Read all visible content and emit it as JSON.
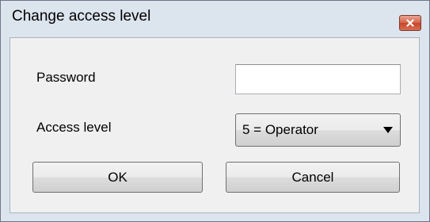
{
  "window": {
    "title": "Change access level",
    "close_icon": "close-icon"
  },
  "form": {
    "password_label": "Password",
    "password_value": "",
    "access_level_label": "Access level",
    "access_level_value": "5 = Operator",
    "dropdown_icon": "dropdown-arrow-icon"
  },
  "buttons": {
    "ok_label": "OK",
    "cancel_label": "Cancel"
  },
  "colors": {
    "close_button": "#d6634a",
    "frame": "#dce4ee",
    "client_background": "#f0f0f0"
  }
}
